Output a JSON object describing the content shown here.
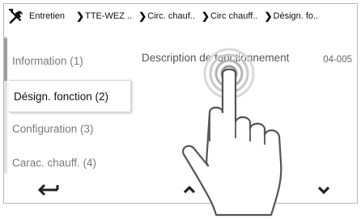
{
  "breadcrumb": {
    "root": "Entretien",
    "items": [
      "TTE-WEZ ..",
      "Circ. chauf..",
      "Circ chauff..",
      "Désign. fo.."
    ],
    "root_icon": "tools-icon"
  },
  "sidebar": {
    "items": [
      {
        "label": "Information (1)",
        "active": false
      },
      {
        "label": "Désign. fonction (2)",
        "active": true
      },
      {
        "label": "Configuration (3)",
        "active": false
      },
      {
        "label": "Carac. chauff. (4)",
        "active": false
      }
    ]
  },
  "content": {
    "title": "Description de fonctionnement",
    "code": "04-005"
  },
  "nav": {
    "back_icon": "back-arrow-icon",
    "up_icon": "chevron-up-icon",
    "down_icon": "chevron-down-icon"
  },
  "overlay": {
    "gesture_icon": "hand-tap-icon"
  }
}
